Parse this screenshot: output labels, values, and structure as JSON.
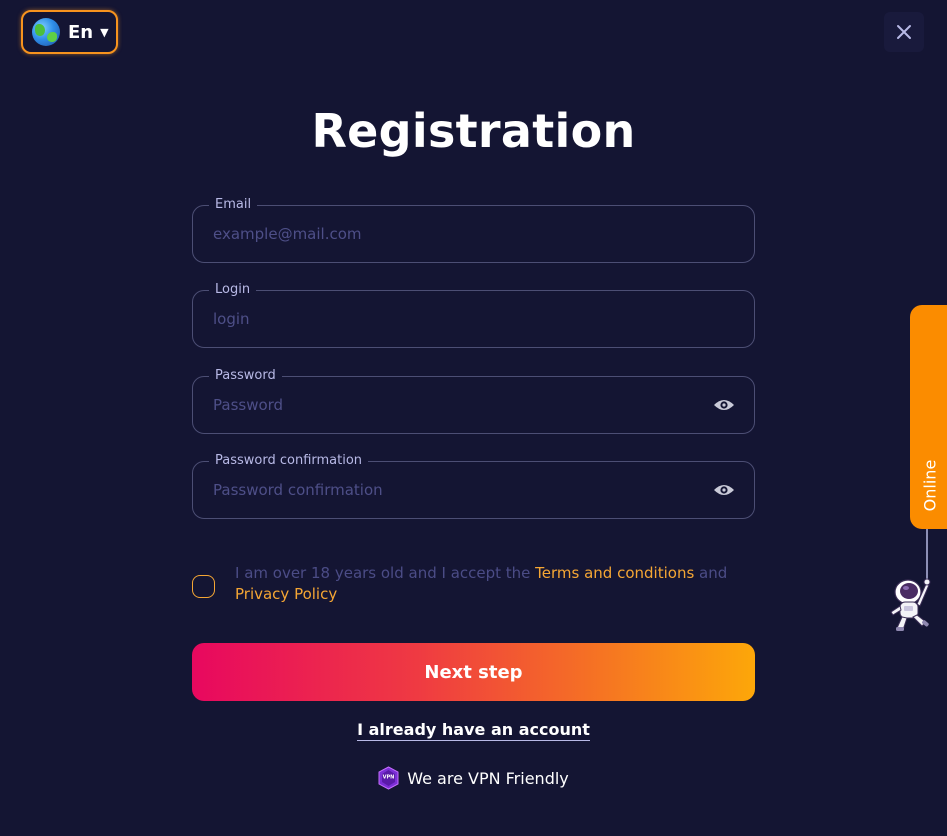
{
  "header": {
    "language": {
      "label": "En",
      "icon": "globe-icon",
      "caret_icon": "caret-down-icon"
    },
    "close_icon": "close-icon"
  },
  "title": "Registration",
  "form": {
    "fields": [
      {
        "label": "Email",
        "value": "",
        "placeholder": "example@mail.com",
        "type": "email",
        "has_eye": false
      },
      {
        "label": "Login",
        "value": "",
        "placeholder": "login",
        "type": "text",
        "has_eye": false
      },
      {
        "label": "Password",
        "value": "",
        "placeholder": "Password",
        "type": "password",
        "has_eye": true
      },
      {
        "label": "Password confirmation",
        "value": "",
        "placeholder": "Password confirmation",
        "type": "password",
        "has_eye": true
      }
    ],
    "agreement": {
      "checked": false,
      "text_before": "I am over 18 years old and I accept the ",
      "terms_link": "Terms and conditions",
      "text_middle": " and ",
      "privacy_link": "Privacy Policy"
    },
    "submit_label": "Next step",
    "login_link": "I already have an account"
  },
  "footer": {
    "vpn_badge_text": "VPN",
    "vpn_text": "We are VPN Friendly"
  },
  "side_tab": {
    "label": "Online"
  },
  "colors": {
    "background": "#141533",
    "accent_orange": "#f5a634",
    "online_tab": "#fb8c00",
    "button_gradient_start": "#e8085f",
    "button_gradient_end": "#fda709"
  }
}
